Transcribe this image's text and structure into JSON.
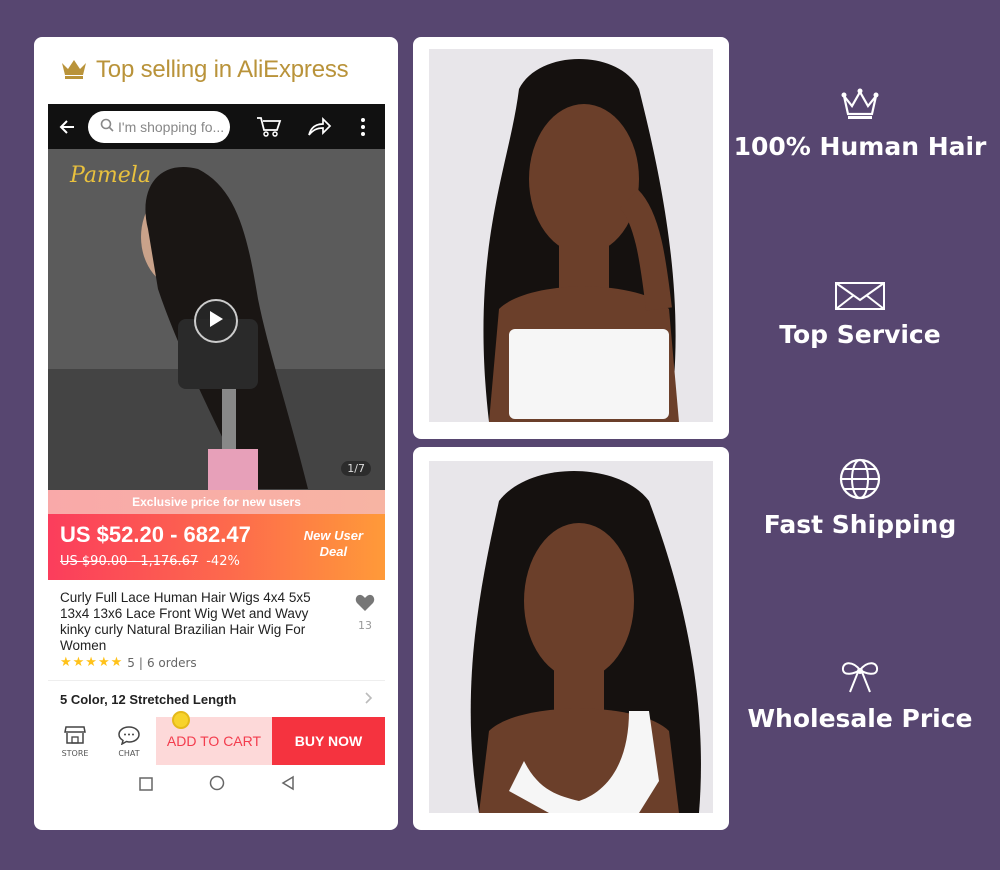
{
  "header": {
    "title": "Top selling in AliExpress"
  },
  "topbar": {
    "search_placeholder": "I'm shopping fo..."
  },
  "product": {
    "brand_watermark": "Pamela",
    "image_counter": "1/7",
    "promo_text": "Exclusive price for new users",
    "price": "US $52.20 - 682.47",
    "old_price": "US $90.00 - 1,176.67",
    "discount": "-42%",
    "deal_badge_line1": "New User",
    "deal_badge_line2": "Deal",
    "title": "Curly Full Lace Human Hair Wigs 4x4 5x5 13x4 13x6 Lace Front Wig Wet and Wavy kinky curly Natural Brazilian Hair Wig For Women",
    "wishlist_count": "13",
    "rating_stars": "★★★★★",
    "rating": "5",
    "orders": "6 orders",
    "sku_summary": "5 Color, 12 Stretched Length"
  },
  "actions": {
    "store_label": "STORE",
    "chat_label": "CHAT",
    "add_to_cart": "ADD TO CART",
    "buy_now": "BUY NOW"
  },
  "features": [
    {
      "icon": "crown-icon",
      "label": "100% Human Hair"
    },
    {
      "icon": "envelope-icon",
      "label": "Top Service"
    },
    {
      "icon": "globe-icon",
      "label": "Fast Shipping"
    },
    {
      "icon": "bow-icon",
      "label": "Wholesale Price"
    }
  ],
  "colors": {
    "background": "#574670",
    "price_gradient_start": "#fb3d5c",
    "price_gradient_end": "#ff9a39",
    "buy_button": "#f5333f",
    "gold": "#b9933a"
  }
}
